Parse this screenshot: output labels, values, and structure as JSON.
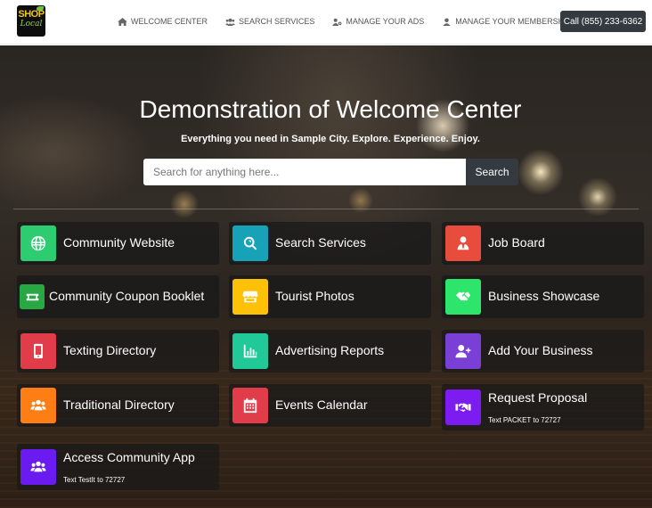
{
  "nav": {
    "logo_line1": "SHOP",
    "logo_line2": "Local",
    "links": [
      {
        "label": "WELCOME CENTER",
        "icon": "home-icon"
      },
      {
        "label": "SEARCH SERVICES",
        "icon": "users-icon"
      },
      {
        "label": "MANAGE YOUR ADS",
        "icon": "user-cog-icon"
      },
      {
        "label": "MANAGE YOUR MEMBERSHIP",
        "icon": "user-icon"
      }
    ],
    "call_label": "Call (855) 233-6362"
  },
  "hero": {
    "title": "Demonstration of Welcome Center",
    "subtitle": "Everything you need in Sample City. Explore. Experience. Enjoy.",
    "search": {
      "placeholder": "Search for anything here...",
      "button": "Search"
    }
  },
  "tiles": [
    {
      "label": "Community Website",
      "color": "#2ecc71",
      "icon": "globe-icon"
    },
    {
      "label": "Search Services",
      "color": "#17a2b8",
      "icon": "search-icon"
    },
    {
      "label": "Job Board",
      "color": "#e74c3c",
      "icon": "user-tie-icon"
    },
    {
      "label": "Community Coupon Booklet",
      "color": "#28a745",
      "icon": "ticket-icon"
    },
    {
      "label": "Tourist Photos",
      "color": "#ffc107",
      "icon": "store-icon"
    },
    {
      "label": "Business Showcase",
      "color": "#2ee56b",
      "icon": "handshake-icon"
    },
    {
      "label": "Texting Directory",
      "color": "#e03c4a",
      "icon": "mobile-icon"
    },
    {
      "label": "Advertising Reports",
      "color": "#20c997",
      "icon": "chart-icon"
    },
    {
      "label": "Add Your Business",
      "color": "#7a3fd4",
      "icon": "user-plus-icon"
    },
    {
      "label": "Traditional Directory",
      "color": "#fd7e14",
      "icon": "users-icon"
    },
    {
      "label": "Events Calendar",
      "color": "#e03c4a",
      "icon": "calendar-icon"
    },
    {
      "label": "Request Proposal",
      "sub": "Text PACKET to 72727",
      "color": "#7c1cf0",
      "icon": "handshake-icon"
    },
    {
      "label": "Access Community App",
      "sub": "Text TestIt to 72727",
      "color": "#6a1cf0",
      "icon": "users-icon"
    }
  ]
}
